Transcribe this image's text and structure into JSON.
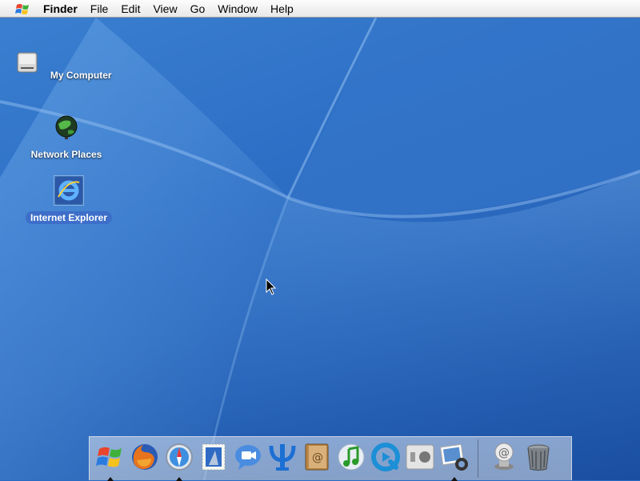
{
  "menubar": {
    "apple_icon": "windows-flag-icon",
    "app_name": "Finder",
    "items": [
      "File",
      "Edit",
      "View",
      "Go",
      "Window",
      "Help"
    ]
  },
  "desktop": {
    "icons": [
      {
        "label": "My Computer",
        "icon": "hard-drive-icon",
        "selected": false
      },
      {
        "label": "Network Places",
        "icon": "network-globe-icon",
        "selected": false
      },
      {
        "label": "Internet Explorer",
        "icon": "internet-explorer-icon",
        "selected": true
      }
    ]
  },
  "dock": {
    "apps": [
      {
        "icon": "windows-start-icon",
        "running": true
      },
      {
        "icon": "firefox-icon",
        "running": false
      },
      {
        "icon": "safari-compass-icon",
        "running": true
      },
      {
        "icon": "mail-stamp-icon",
        "running": false
      },
      {
        "icon": "ichat-camera-icon",
        "running": false
      },
      {
        "icon": "psi-icon",
        "running": false
      },
      {
        "icon": "address-book-icon",
        "running": false
      },
      {
        "icon": "itunes-icon",
        "running": false
      },
      {
        "icon": "quicktime-icon",
        "running": false
      },
      {
        "icon": "boot-camp-icon",
        "running": false
      },
      {
        "icon": "iphoto-icon",
        "running": true
      }
    ],
    "others": [
      {
        "icon": "internet-connect-icon"
      },
      {
        "icon": "trash-icon"
      }
    ]
  },
  "colors": {
    "desktop_blue": "#2a6cc4",
    "selection": "#3d6ec9"
  }
}
